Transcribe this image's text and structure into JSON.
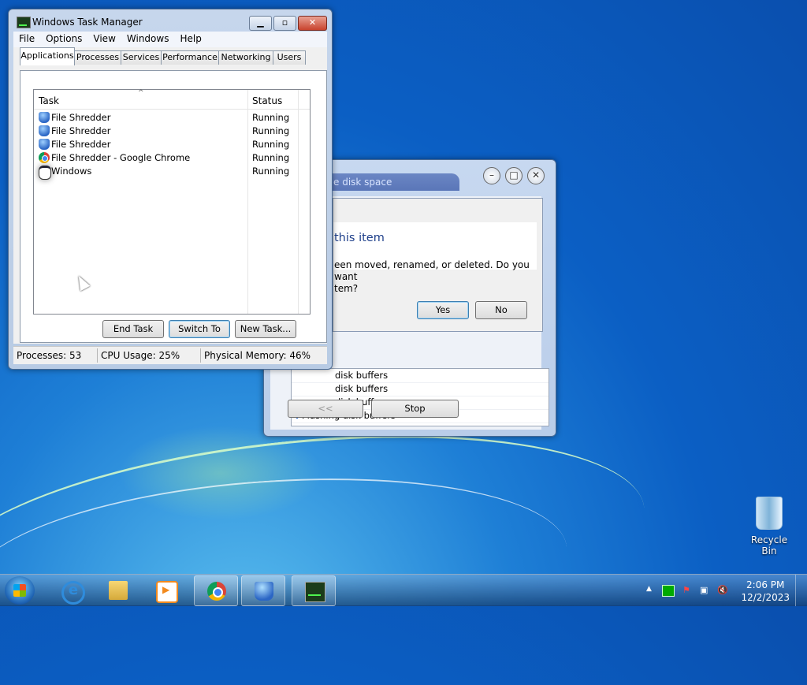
{
  "taskmgr": {
    "title": "Windows Task Manager",
    "menu": [
      "File",
      "Options",
      "View",
      "Windows",
      "Help"
    ],
    "tabs": [
      "Applications",
      "Processes",
      "Services",
      "Performance",
      "Networking",
      "Users"
    ],
    "columns": {
      "task": "Task",
      "status": "Status"
    },
    "rows": [
      {
        "name": "File Shredder",
        "status": "Running",
        "icon": "shredder-icon"
      },
      {
        "name": "File Shredder",
        "status": "Running",
        "icon": "shredder-icon"
      },
      {
        "name": "File Shredder",
        "status": "Running",
        "icon": "shredder-icon"
      },
      {
        "name": "File Shredder - Google Chrome",
        "status": "Running",
        "icon": "chrome-icon"
      },
      {
        "name": "Windows",
        "status": "Running",
        "icon": "window-icon"
      }
    ],
    "buttons": {
      "end_task": "End Task",
      "switch_to": "Switch To",
      "new_task": "New Task..."
    },
    "status": {
      "processes": "Processes: 53",
      "cpu": "CPU Usage: 25%",
      "memory": "Physical Memory: 46%"
    }
  },
  "shredder_window": {
    "caption": "e disk space",
    "controls": {
      "min": "–",
      "max": "□",
      "close": "✕"
    },
    "dialog": {
      "title": "this item",
      "message_line1": "een moved, renamed, or deleted. Do you want",
      "message_line2": "tem?",
      "yes": "Yes",
      "no": "No"
    },
    "log": [
      "disk buffers",
      "disk buffers",
      "disk buffers",
      "Flushing disk buffers"
    ],
    "back_button": "<<",
    "stop_button": "Stop"
  },
  "desktop": {
    "recycle_bin": "Recycle Bin"
  },
  "taskbar": {
    "items": [
      "ie-icon",
      "folder-icon",
      "media-player-icon",
      "chrome-icon",
      "file-shredder-icon",
      "task-manager-icon"
    ],
    "time": "2:06 PM",
    "date": "12/2/2023"
  },
  "colors": {
    "accent": "#1e7fd6",
    "dialog_title": "#1e3f8a",
    "chrome_red": "#db4437"
  }
}
